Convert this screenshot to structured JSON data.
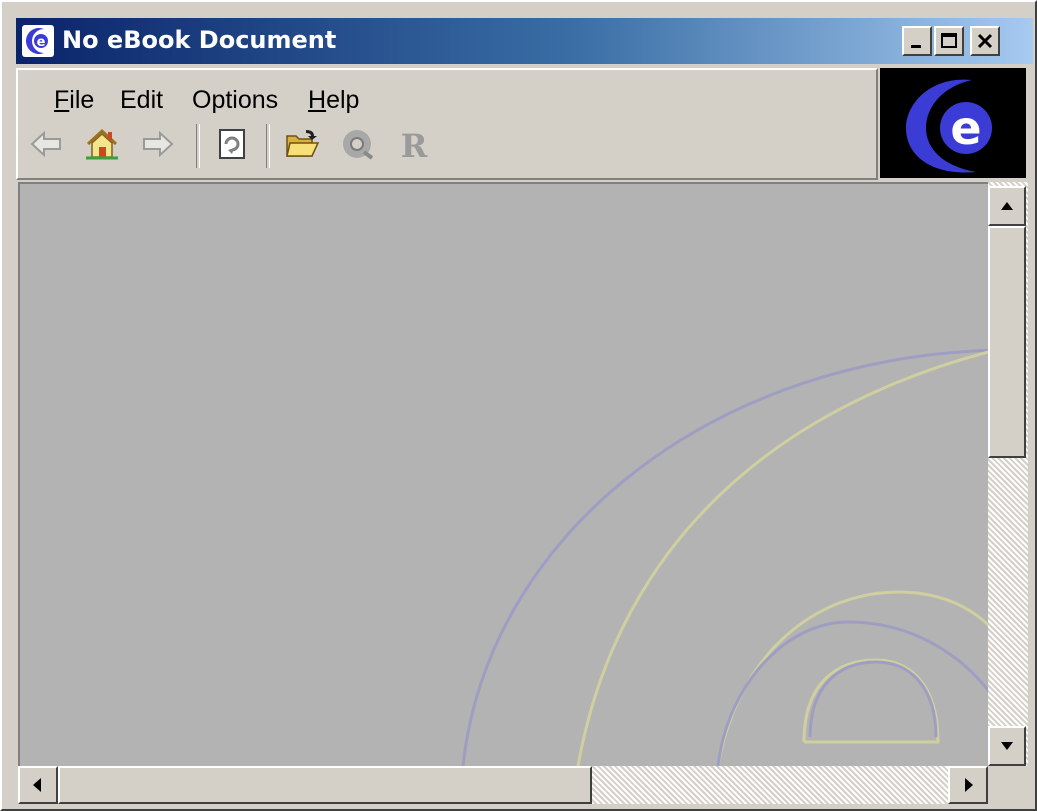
{
  "window": {
    "title": "No eBook Document",
    "controls": {
      "minimize_icon": "minimize-icon",
      "maximize_icon": "maximize-icon",
      "close_icon": "close-icon"
    }
  },
  "menu": {
    "items": [
      {
        "label": "File",
        "mnemonic": "F"
      },
      {
        "label": "Edit",
        "mnemonic": ""
      },
      {
        "label": "Options",
        "mnemonic": ""
      },
      {
        "label": "Help",
        "mnemonic": "H"
      }
    ]
  },
  "toolbar": {
    "icons": [
      "back-arrow-icon",
      "home-icon",
      "forward-arrow-icon",
      "refresh-page-icon",
      "open-folder-icon",
      "disc-icon",
      "rights-icon"
    ]
  },
  "brand": {
    "logo": "e-logo-icon"
  },
  "colors": {
    "title_gradient_start": "#0a246a",
    "title_gradient_end": "#a6caf0",
    "content_background": "#b3b3b3",
    "window_face": "#d4d0c8",
    "logo_blue": "#3b3bd6"
  }
}
